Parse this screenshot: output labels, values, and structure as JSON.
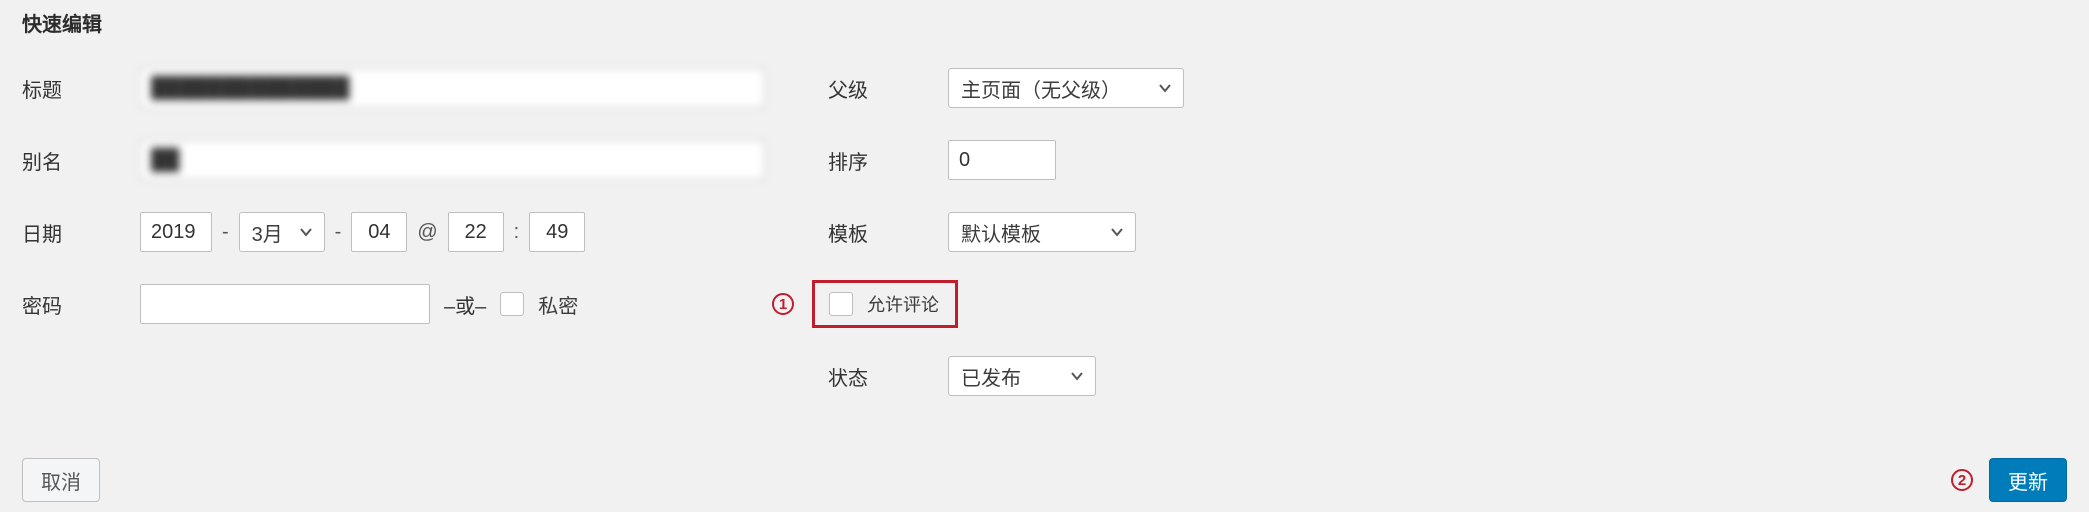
{
  "heading": "快速编辑",
  "left": {
    "title_label": "标题",
    "title_value": "██████████████",
    "slug_label": "别名",
    "slug_value": "██",
    "date_label": "日期",
    "year": "2019",
    "month": "3月",
    "day": "04",
    "hour": "22",
    "minute": "49",
    "at_symbol": "@",
    "colon": ":",
    "dash": "-",
    "password_label": "密码",
    "password_value": "",
    "or_text": "–或–",
    "private_label": "私密"
  },
  "right": {
    "parent_label": "父级",
    "parent_value": "主页面（无父级）",
    "order_label": "排序",
    "order_value": "0",
    "template_label": "模板",
    "template_value": "默认模板",
    "allow_comments_label": "允许评论",
    "status_label": "状态",
    "status_value": "已发布"
  },
  "footer": {
    "cancel": "取消",
    "update": "更新"
  },
  "callouts": {
    "one": "1",
    "two": "2"
  }
}
